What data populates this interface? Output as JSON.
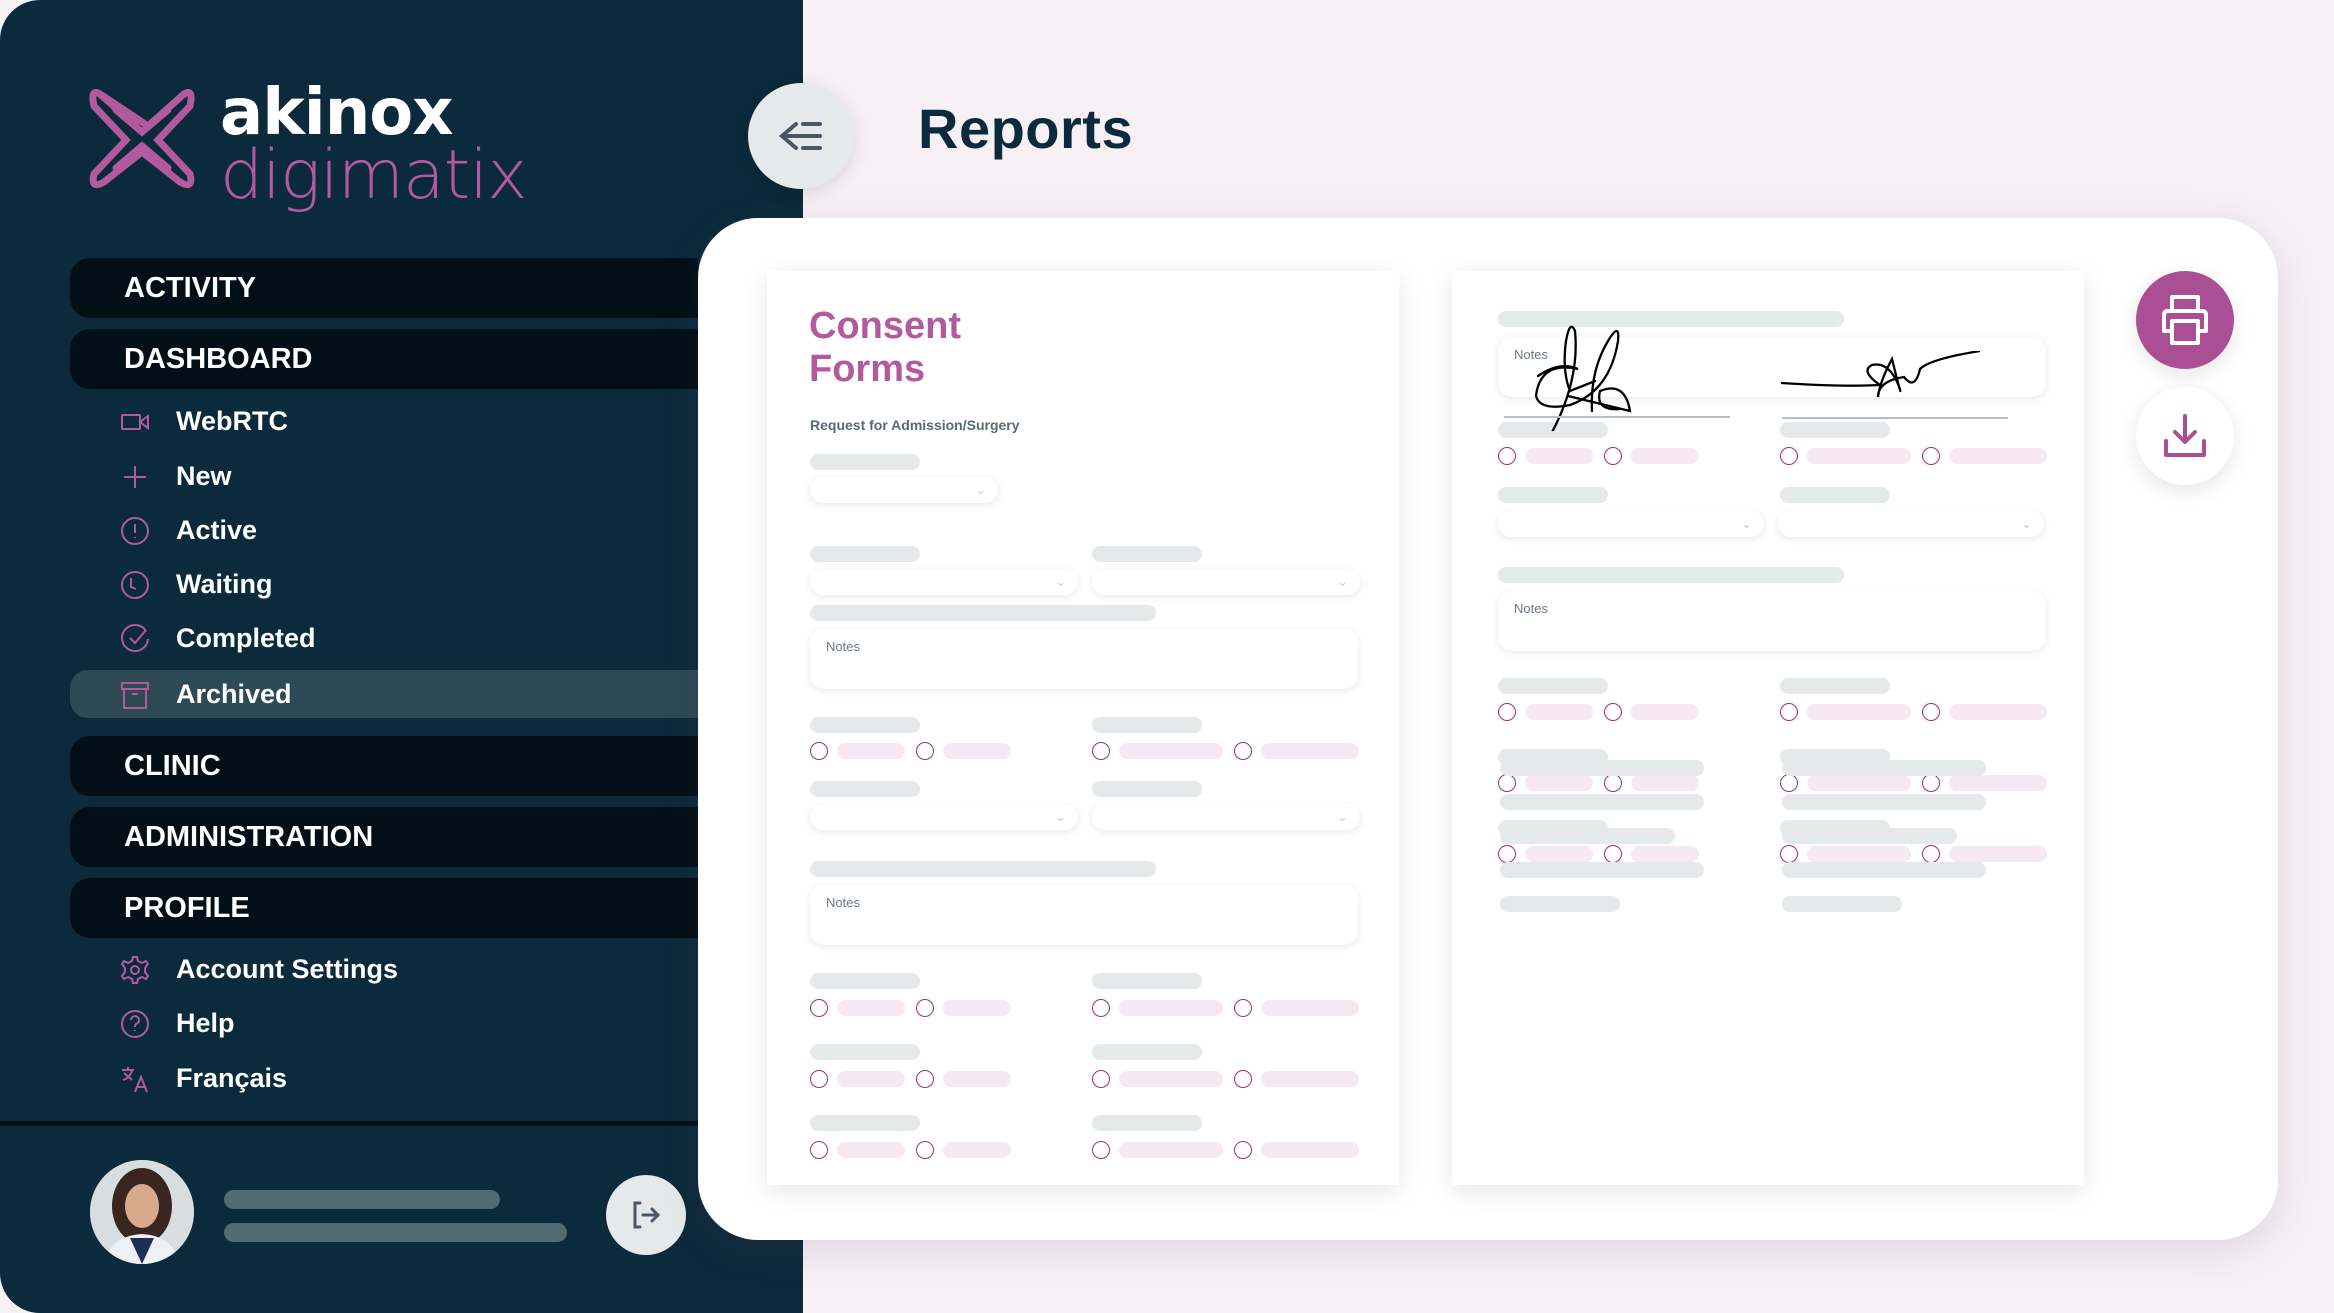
{
  "brand": {
    "line1": "akinox",
    "line2": "digimatix",
    "accent": "#b35a9f",
    "sidebar_bg": "#0b2a3b"
  },
  "header": {
    "title": "Reports"
  },
  "nav": {
    "activity": "ACTIVITY",
    "dashboard": "DASHBOARD",
    "dashboard_items": [
      {
        "label": "WebRTC",
        "icon": "video-camera-icon"
      },
      {
        "label": "New",
        "icon": "plus-icon"
      },
      {
        "label": "Active",
        "icon": "alert-circle-icon"
      },
      {
        "label": "Waiting",
        "icon": "clock-icon"
      },
      {
        "label": "Completed",
        "icon": "check-circle-icon"
      },
      {
        "label": "Archived",
        "icon": "archive-box-icon",
        "active": true
      }
    ],
    "clinic": "CLINIC",
    "administration": "ADMINISTRATION",
    "profile": "PROFILE",
    "profile_items": [
      {
        "label": "Account Settings",
        "icon": "gear-icon"
      },
      {
        "label": "Help",
        "icon": "help-circle-icon"
      },
      {
        "label": "Français",
        "icon": "translate-icon"
      }
    ]
  },
  "document_left": {
    "title_line1": "Consent",
    "title_line2": "Forms",
    "subtitle": "Request for Admission/Surgery",
    "notes_labels": [
      "Notes",
      "Notes"
    ]
  },
  "document_right": {
    "notes_labels": [
      "Notes",
      "Notes"
    ]
  },
  "actions": {
    "print": "print-icon",
    "download": "download-icon"
  }
}
